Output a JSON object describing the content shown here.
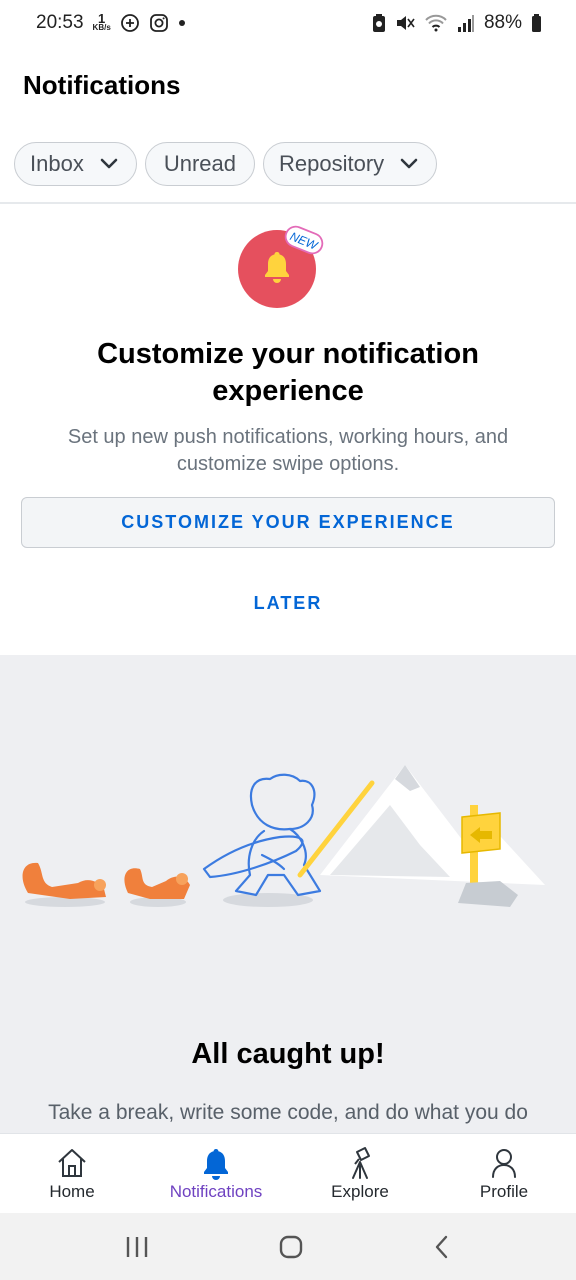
{
  "status_bar": {
    "time": "20:53",
    "data_rate_value": "1",
    "data_rate_unit": "KB/s",
    "battery": "88%"
  },
  "header": {
    "title": "Notifications"
  },
  "filters": [
    {
      "label": "Inbox",
      "has_dropdown": true
    },
    {
      "label": "Unread",
      "has_dropdown": false
    },
    {
      "label": "Repository",
      "has_dropdown": true
    }
  ],
  "promo": {
    "badge_icon": "bell-icon",
    "new_tag": "NEW",
    "title": "Customize your notification experience",
    "subtitle": "Set up new push notifications, working hours, and customize swipe options.",
    "primary_button": "CUSTOMIZE YOUR EXPERIENCE",
    "secondary_button": "LATER"
  },
  "empty_state": {
    "title": "All caught up!",
    "subtitle": "Take a break, write some code, and do what you do"
  },
  "bottom_nav": [
    {
      "label": "Home",
      "icon": "home-icon",
      "active": false
    },
    {
      "label": "Notifications",
      "icon": "bell-icon",
      "active": true
    },
    {
      "label": "Explore",
      "icon": "telescope-icon",
      "active": false
    },
    {
      "label": "Profile",
      "icon": "person-icon",
      "active": false
    }
  ],
  "colors": {
    "accent_blue": "#0366d6",
    "active_purple": "#6f42c1",
    "badge_red": "#e5505e",
    "bell_yellow": "#ffd33d"
  }
}
